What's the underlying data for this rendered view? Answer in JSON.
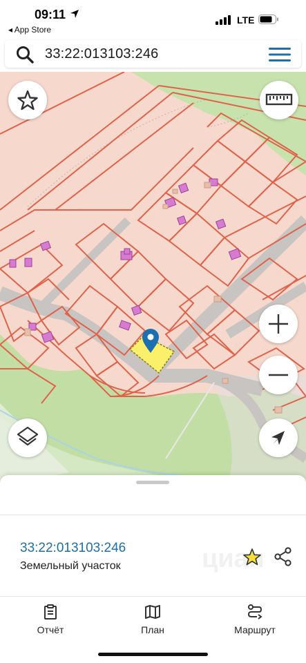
{
  "status_bar": {
    "time": "09:11",
    "back_app": "◂ App Store",
    "network": "LTE"
  },
  "search": {
    "query": "33:22:013103:246"
  },
  "map": {
    "buttons": {
      "favorite": "star-icon",
      "ruler": "ruler-icon",
      "zoom_in": "plus-icon",
      "zoom_out": "minus-icon",
      "layers": "layers-icon",
      "locate": "location-arrow-icon"
    },
    "colors": {
      "parcel_fill": "#f7d8cd",
      "parcel_border": "#e0624a",
      "road": "#c7c3c1",
      "forest": "#c2dea4",
      "building": "#d77bd2",
      "selected_parcel": "#fbf06a",
      "pin": "#1c6fb0"
    }
  },
  "sheet": {
    "parcel_number": "33:22:013103:246",
    "parcel_type": "Земельный участок",
    "watermark": "циан"
  },
  "tabs": [
    {
      "label": "Отчёт",
      "icon": "clipboard-icon"
    },
    {
      "label": "План",
      "icon": "map-icon"
    },
    {
      "label": "Маршрут",
      "icon": "route-icon"
    }
  ]
}
